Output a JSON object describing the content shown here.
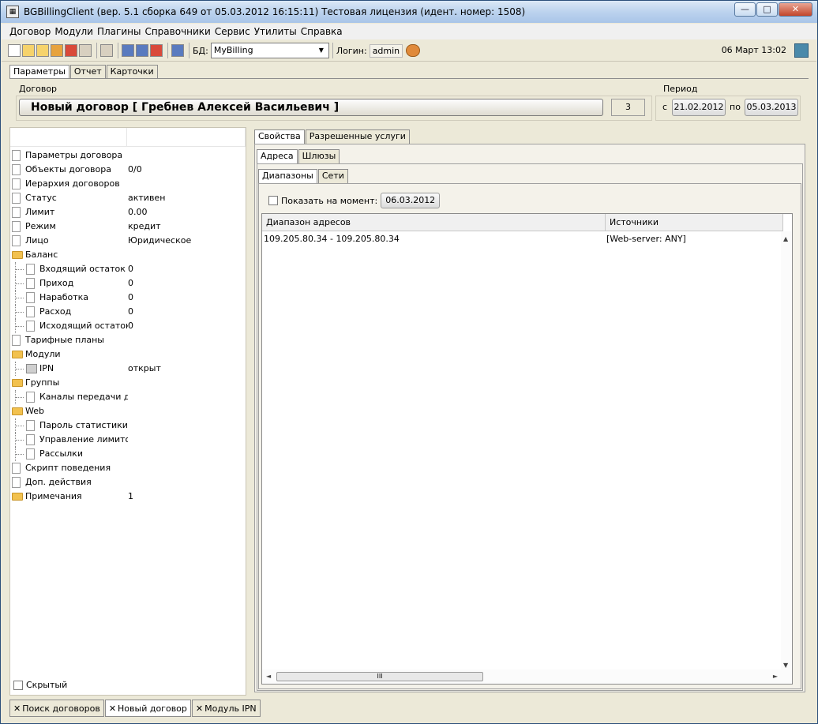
{
  "window": {
    "title": "BGBillingClient (вер. 5.1 сборка 649 от 05.03.2012 16:15:11) Тестовая лицензия (идент. номер: 1508)",
    "buttons": {
      "minimize": "—",
      "maximize": "□",
      "close": "✕"
    }
  },
  "menu": [
    "Договор",
    "Модули",
    "Плагины",
    "Справочники",
    "Сервис",
    "Утилиты",
    "Справка"
  ],
  "toolbar": {
    "db_label": "БД:",
    "db_value": "MyBilling",
    "login_label": "Логин:",
    "login_value": "admin",
    "datetime": "06 Март 13:02"
  },
  "top_tabs": [
    "Параметры",
    "Отчет",
    "Карточки"
  ],
  "contract": {
    "group_label": "Договор",
    "title": "Новый договор [ Гребнев Алексей Васильевич ]",
    "number": "3"
  },
  "period": {
    "group_label": "Период",
    "from_label": "с",
    "from": "21.02.2012",
    "to_label": "по",
    "to": "05.03.2013"
  },
  "tree": [
    {
      "label": "Параметры договора",
      "value": "",
      "icon": "doc-icon",
      "level": 0
    },
    {
      "label": "Объекты договора",
      "value": "0/0",
      "icon": "doc-icon",
      "level": 0
    },
    {
      "label": "Иерархия договоров",
      "value": "",
      "icon": "doc-icon",
      "level": 0
    },
    {
      "label": "Статус",
      "value": "активен",
      "icon": "doc-icon",
      "level": 0
    },
    {
      "label": "Лимит",
      "value": "0.00",
      "icon": "doc-icon",
      "level": 0
    },
    {
      "label": "Режим",
      "value": "кредит",
      "icon": "doc-icon",
      "level": 0
    },
    {
      "label": "Лицо",
      "value": "Юридическое",
      "icon": "doc-icon",
      "level": 0
    },
    {
      "label": "Баланс",
      "value": "",
      "icon": "folder-icon",
      "level": 0
    },
    {
      "label": "Входящий остаток",
      "value": "0",
      "icon": "doc-icon",
      "level": 1
    },
    {
      "label": "Приход",
      "value": "0",
      "icon": "doc-icon",
      "level": 1
    },
    {
      "label": "Наработка",
      "value": "0",
      "icon": "doc-icon",
      "level": 1
    },
    {
      "label": "Расход",
      "value": "0",
      "icon": "doc-icon",
      "level": 1
    },
    {
      "label": "Исходящий остаток",
      "value": "0",
      "icon": "doc-icon",
      "level": 1
    },
    {
      "label": "Тарифные планы",
      "value": "",
      "icon": "doc-icon",
      "level": 0
    },
    {
      "label": "Модули",
      "value": "",
      "icon": "folder-icon",
      "level": 0
    },
    {
      "label": "IPN",
      "value": "открыт",
      "icon": "package-icon",
      "level": 1
    },
    {
      "label": "Группы",
      "value": "",
      "icon": "folder-icon",
      "level": 0
    },
    {
      "label": "Каналы передачи дан",
      "value": "",
      "icon": "doc-icon",
      "level": 1
    },
    {
      "label": "Web",
      "value": "",
      "icon": "folder-icon",
      "level": 0
    },
    {
      "label": "Пароль статистики",
      "value": "",
      "icon": "doc-icon",
      "level": 1
    },
    {
      "label": "Управление лимитом",
      "value": "",
      "icon": "doc-icon",
      "level": 1
    },
    {
      "label": "Рассылки",
      "value": "",
      "icon": "doc-icon",
      "level": 1
    },
    {
      "label": "Скрипт поведения",
      "value": "",
      "icon": "doc-icon",
      "level": 0
    },
    {
      "label": "Доп. действия",
      "value": "",
      "icon": "doc-icon",
      "level": 0
    },
    {
      "label": "Примечания",
      "value": "1",
      "icon": "folder-icon",
      "level": 0
    }
  ],
  "hidden_checkbox_label": "Скрытый",
  "right_tabs": [
    "Свойства",
    "Разрешенные услуги"
  ],
  "sub_tabs": [
    "Адреса",
    "Шлюзы"
  ],
  "subsub_tabs": [
    "Диапазоны",
    "Сети"
  ],
  "show_moment": {
    "label": "Показать на момент:",
    "date": "06.03.2012"
  },
  "table": {
    "columns": [
      "Диапазон адресов",
      "Источники"
    ],
    "rows": [
      [
        "109.205.80.34 - 109.205.80.34",
        "[Web-server: ANY]"
      ]
    ]
  },
  "bottom_tabs": [
    "Поиск договоров",
    "Новый договор",
    "Модуль IPN"
  ]
}
